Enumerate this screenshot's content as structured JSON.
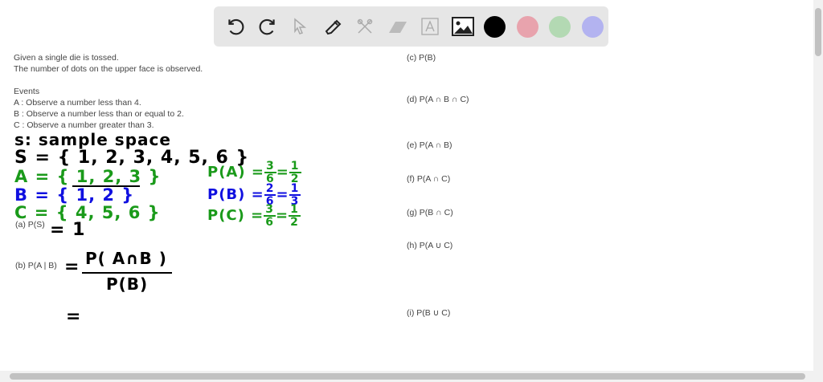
{
  "toolbar": {
    "tools": [
      "undo-icon",
      "redo-icon",
      "select-icon",
      "pen-icon",
      "tools-icon",
      "eraser-icon",
      "text-icon",
      "image-icon"
    ],
    "colors": [
      "#000000",
      "#e8a3ad",
      "#b3d9b3",
      "#b3b3f0"
    ]
  },
  "problem": {
    "line1": "Given a single die is tossed.",
    "line2": "The number of dots on the upper face is observed.",
    "events_title": "Events",
    "event_a": "A : Observe a number less than 4.",
    "event_b": "B : Observe a number less than or equal to 2.",
    "event_c": "C : Observe a number greater than 3."
  },
  "questions": {
    "a": "(a) P(S)",
    "b": "(b) P(A | B)",
    "c": "(c) P(B)",
    "d": "(d) P(A ∩ B ∩ C)",
    "e": "(e) P(A ∩ B)",
    "f": "(f) P(A ∩ C)",
    "g": "(g) P(B ∩ C)",
    "h": "(h) P(A ∪ C)",
    "i": "(i) P(B ∪ C)"
  },
  "handwriting": {
    "sample_space_label": "s: sample space",
    "s_set": "S = { 1, 2, 3, 4, 5, 6 }",
    "a_set": "A = { 1, 2, 3 }",
    "b_set": "B = { 1, 2 }",
    "c_set": "C = { 4, 5, 6 }",
    "pa_prefix": "P(A) =",
    "pa_num": "3",
    "pa_den": "6",
    "pa_num2": "1",
    "pa_den2": "2",
    "pb_prefix": "P(B) =",
    "pb_num": "2",
    "pb_den": "6",
    "pb_num2": "1",
    "pb_den2": "3",
    "pc_prefix": "P(C) =",
    "pc_num": "3",
    "pc_den": "6",
    "pc_num2": "1",
    "pc_den2": "2",
    "eq_sign": "=",
    "ans_a": "= 1",
    "ans_b_num": "P( A∩B )",
    "ans_b_den": "P(B)",
    "ans_b_eq2": "="
  },
  "colors": {
    "black": "#000000",
    "green": "#1a9a1a",
    "blue": "#1010e0"
  }
}
